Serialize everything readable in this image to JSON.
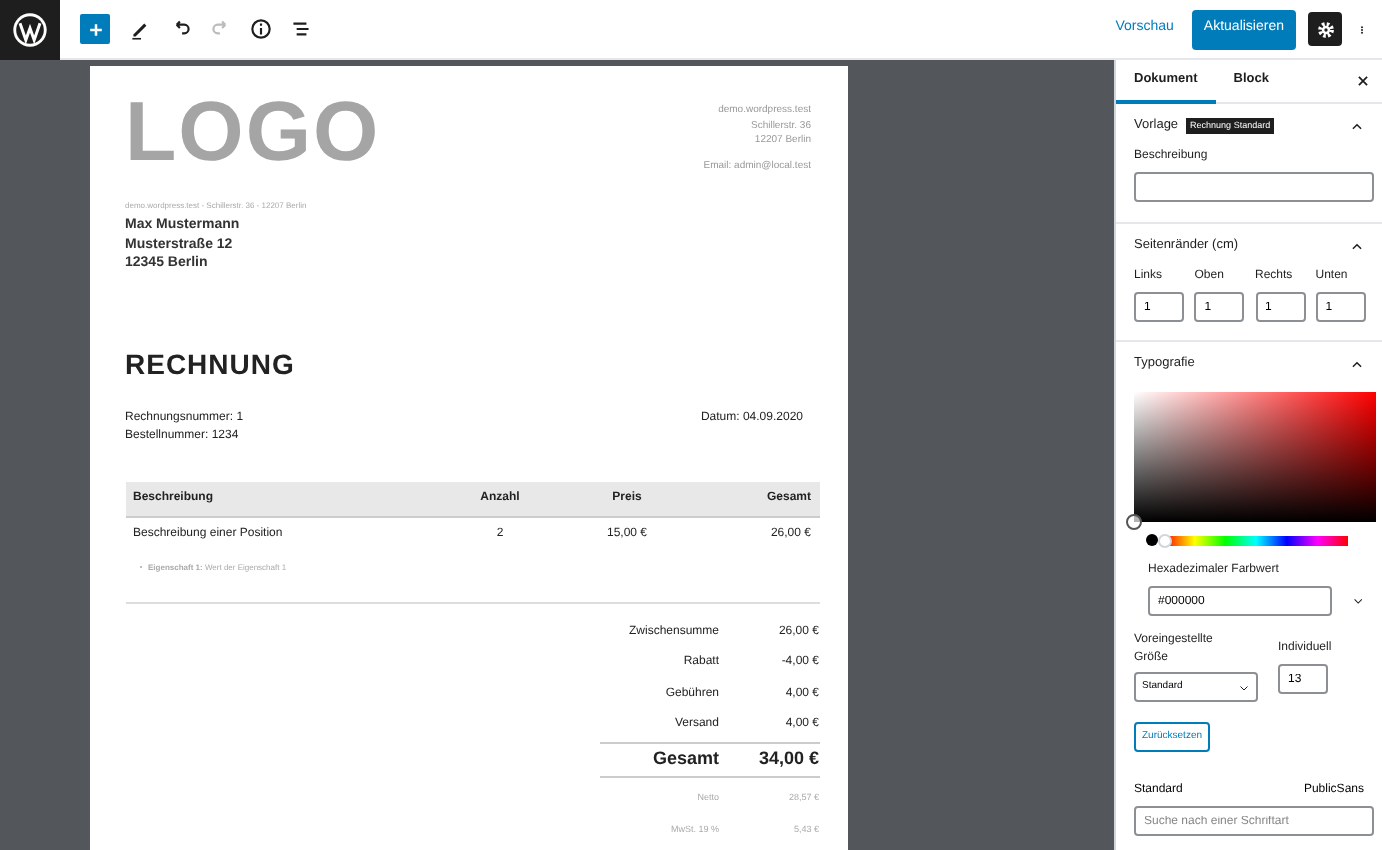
{
  "toolbar": {
    "preview": "Vorschau",
    "update": "Aktualisieren"
  },
  "invoice": {
    "logo": "LOGO",
    "shop_address": [
      "demo.wordpress.test",
      "Schillerstr. 36",
      "12207 Berlin"
    ],
    "shop_email": "Email: admin@local.test",
    "sender_line": "demo.wordpress.test - Schillerstr. 36 - 12207 Berlin",
    "recipient": [
      "Max Mustermann",
      "Musterstraße 12",
      "12345 Berlin"
    ],
    "title": "RECHNUNG",
    "meta": [
      "Rechnungsnummer: 1",
      "Bestellnummer: 1234"
    ],
    "date": "Datum: 04.09.2020",
    "table": {
      "columns": [
        "Beschreibung",
        "Anzahl",
        "Preis",
        "Gesamt"
      ],
      "rows": [
        {
          "cells": [
            "Beschreibung einer Position",
            "2",
            "15,00 €",
            "26,00 €"
          ],
          "property_label": "Eigenschaft 1:",
          "property_value": "Wert der Eigenschaft 1"
        }
      ]
    },
    "totals": [
      {
        "kind": "normal",
        "label": "Zwischensumme",
        "value": "26,00 €"
      },
      {
        "kind": "normal",
        "label": "Rabatt",
        "value": "-4,00 €"
      },
      {
        "kind": "normal",
        "label": "Gebühren",
        "value": "4,00 €"
      },
      {
        "kind": "normal",
        "label": "Versand",
        "value": "4,00 €"
      },
      {
        "kind": "grand",
        "label": "Gesamt",
        "value": "34,00 €"
      },
      {
        "kind": "muted",
        "label": "Netto",
        "value": "28,57 €"
      },
      {
        "kind": "muted",
        "label": "MwSt. 19 %",
        "value": "5,43 €"
      }
    ]
  },
  "sidebar": {
    "tabs": [
      {
        "label": "Dokument",
        "selected": true
      },
      {
        "label": "Block",
        "selected": false
      }
    ],
    "template": {
      "title": "Vorlage",
      "badge": "Rechnung Standard",
      "expanded": true,
      "description_label": "Beschreibung"
    },
    "margins": {
      "title": "Seitenränder (cm)",
      "expanded": true,
      "fields": [
        {
          "label": "Links",
          "value": "1"
        },
        {
          "label": "Oben",
          "value": "1"
        },
        {
          "label": "Rechts",
          "value": "1"
        },
        {
          "label": "Unten",
          "value": "1"
        }
      ]
    },
    "typography": {
      "title": "Typografie",
      "expanded": true,
      "hue": {
        "level": 0
      },
      "hex_label": "Hexadezimaler Farbwert",
      "hex_value": "#000000",
      "preset_label": "Voreingestellte Größe",
      "preset_value": "Standard",
      "custom_label": "Individuell",
      "custom_value": "13",
      "reset": "Zurücksetzen",
      "font_label": "Standard",
      "font_value": "PublicSans",
      "font_search_placeholder": "Suche nach einer Schriftart"
    }
  }
}
